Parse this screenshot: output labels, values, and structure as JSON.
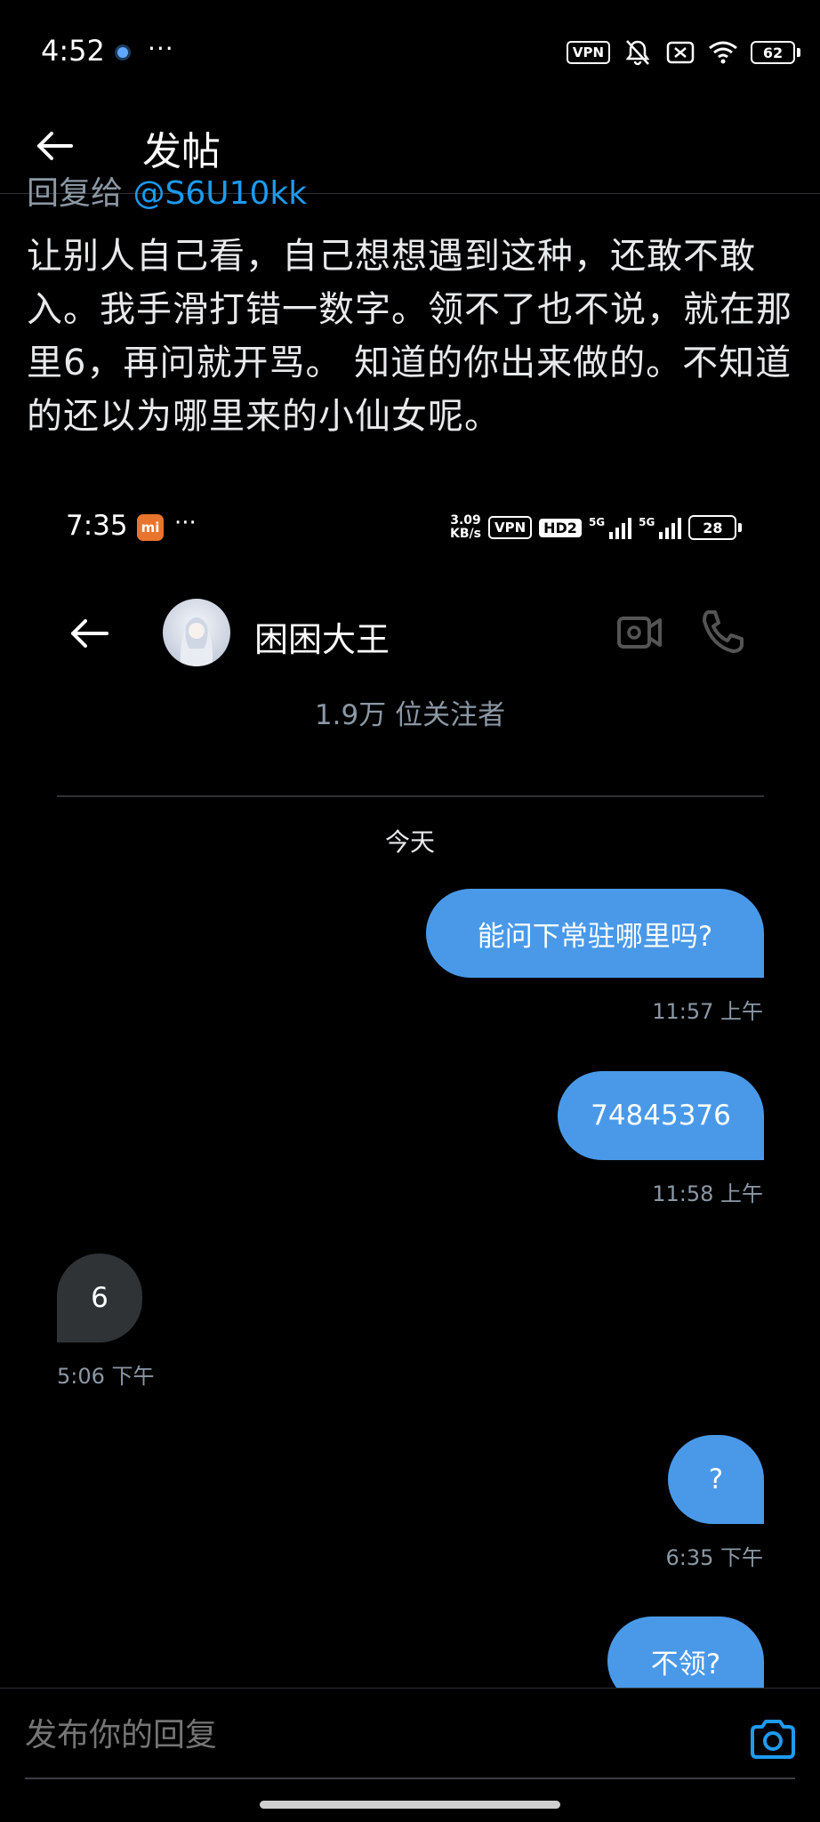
{
  "status_bar": {
    "time": "4:52",
    "more": "···",
    "vpn": "VPN",
    "battery": "62"
  },
  "header": {
    "title": "发帖"
  },
  "post": {
    "reply_to_prefix": "回复给",
    "reply_to_handle": "@S6U10kk",
    "text": "让别人自己看，自己想想遇到这种，还敢不敢入。我手滑打错一数字。领不了也不说，就在那里6，再问就开骂。 知道的你出来做的。不知道的还以为哪里来的小仙女呢。"
  },
  "embedded_screenshot": {
    "status_bar": {
      "time": "7:35",
      "mi": "mi",
      "more": "···",
      "speed_top": "3.09",
      "speed_bottom": "KB/s",
      "vpn": "VPN",
      "hd": "HD2",
      "net1": "5G",
      "net2": "5G",
      "battery": "28"
    },
    "chat": {
      "name": "困困大王",
      "followers": "1.9万 位关注者",
      "date_label": "今天",
      "messages": [
        {
          "direction": "out",
          "text": "能问下常驻哪里吗?",
          "time": "11:57 上午"
        },
        {
          "direction": "out",
          "text": "74845376",
          "time": "11:58 上午"
        },
        {
          "direction": "in",
          "text": "6",
          "time": "5:06 下午"
        },
        {
          "direction": "out",
          "text": "?",
          "time": "6:35 下午"
        },
        {
          "direction": "out",
          "text": "不领?",
          "time": ""
        }
      ]
    }
  },
  "reply_bar": {
    "placeholder": "发布你的回复"
  },
  "colors": {
    "background": "#000000",
    "accent_blue": "#1d9bf0",
    "bubble_out": "#4a99e9",
    "bubble_in": "#2f3336",
    "muted_text": "#8b98a5"
  },
  "icons": [
    "back-arrow-icon",
    "camera-icon",
    "video-call-icon",
    "phone-call-icon",
    "mute-icon",
    "wifi-icon",
    "battery-icon"
  ]
}
